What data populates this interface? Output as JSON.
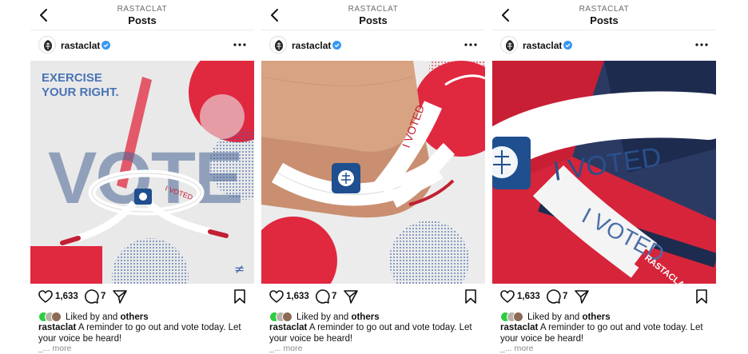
{
  "posts": [
    {
      "topbar": {
        "account_caps": "RASTACLAT",
        "title": "Posts"
      },
      "header": {
        "username": "rastaclat"
      },
      "media": {
        "line1": "EXERCISE",
        "line2": "YOUR RIGHT.",
        "big_word": "VOTE",
        "lace_text": "I VOTED",
        "mark": "≠"
      },
      "actions": {
        "likes": "1,633",
        "comments": "7"
      },
      "liked": {
        "prefix": "Liked by",
        "and": "and",
        "others": "others"
      },
      "caption": {
        "username": "rastaclat",
        "text": "A reminder to go out and vote today. Let your voice be heard!",
        "more": "_... more"
      }
    },
    {
      "topbar": {
        "account_caps": "RASTACLAT",
        "title": "Posts"
      },
      "header": {
        "username": "rastaclat"
      },
      "media": {
        "lace_text": "I VOTED"
      },
      "actions": {
        "likes": "1,633",
        "comments": "7"
      },
      "liked": {
        "prefix": "Liked by",
        "and": "and",
        "others": "others"
      },
      "caption": {
        "username": "rastaclat",
        "text": "A reminder to go out and vote today. Let your voice be heard!",
        "more": "_... more"
      }
    },
    {
      "topbar": {
        "account_caps": "RASTACLAT",
        "title": "Posts"
      },
      "header": {
        "username": "rastaclat"
      },
      "media": {
        "lace_text": "I VOTED",
        "tip_text": "RASTACLA"
      },
      "actions": {
        "likes": "1,633",
        "comments": "7"
      },
      "liked": {
        "prefix": "Liked by",
        "and": "and",
        "others": "others"
      },
      "caption": {
        "username": "rastaclat",
        "text": "A reminder to go out and vote today. Let your voice be heard!",
        "more": "_... more"
      }
    }
  ],
  "colors": {
    "verified": "#3897f0",
    "brand_red": "#e0283f",
    "brand_blue": "#2a4f8a",
    "like_avatar_green": "#2ecc40"
  },
  "icons": [
    "back-icon",
    "verified-icon",
    "more-icon",
    "heart-icon",
    "comment-icon",
    "share-icon",
    "bookmark-icon"
  ]
}
